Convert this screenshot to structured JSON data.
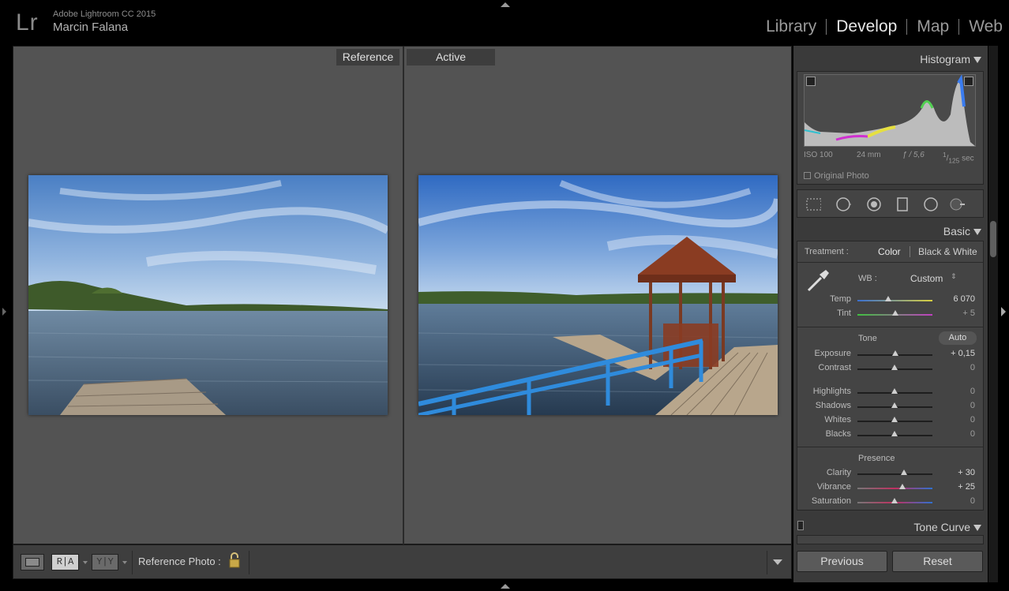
{
  "app": {
    "title": "Adobe Lightroom CC 2015",
    "user": "Marcin Falana",
    "logo": "Lr"
  },
  "modules": [
    {
      "label": "Library",
      "active": false
    },
    {
      "label": "Develop",
      "active": true
    },
    {
      "label": "Map",
      "active": false
    },
    {
      "label": "Web",
      "active": false
    }
  ],
  "compare": {
    "reference_label": "Reference",
    "active_label": "Active"
  },
  "toolbar": {
    "reference_photo_label": "Reference Photo :",
    "view_ra": "R|A",
    "view_yy": "Y|Y"
  },
  "histogram": {
    "title": "Histogram",
    "iso": "ISO 100",
    "focal": "24 mm",
    "aperture": "ƒ / 5,6",
    "shutter_num": "1",
    "shutter_den": "125",
    "shutter_unit": "sec",
    "original_photo": "Original Photo"
  },
  "basic": {
    "title": "Basic",
    "treatment_label": "Treatment :",
    "treatment_color": "Color",
    "treatment_bw": "Black & White",
    "wb_label": "WB :",
    "wb_value": "Custom",
    "temp": {
      "label": "Temp",
      "value": "6 070",
      "pos": 0.42
    },
    "tint": {
      "label": "Tint",
      "value": "+ 5",
      "pos": 0.52
    },
    "tone_label": "Tone",
    "auto_label": "Auto",
    "exposure": {
      "label": "Exposure",
      "value": "+ 0,15",
      "pos": 0.51
    },
    "contrast": {
      "label": "Contrast",
      "value": "0",
      "pos": 0.5
    },
    "highlights": {
      "label": "Highlights",
      "value": "0",
      "pos": 0.5
    },
    "shadows": {
      "label": "Shadows",
      "value": "0",
      "pos": 0.5
    },
    "whites": {
      "label": "Whites",
      "value": "0",
      "pos": 0.5
    },
    "blacks": {
      "label": "Blacks",
      "value": "0",
      "pos": 0.5
    },
    "presence_label": "Presence",
    "clarity": {
      "label": "Clarity",
      "value": "+ 30",
      "pos": 0.63
    },
    "vibrance": {
      "label": "Vibrance",
      "value": "+ 25",
      "pos": 0.61
    },
    "saturation": {
      "label": "Saturation",
      "value": "0",
      "pos": 0.5
    }
  },
  "tone_curve": {
    "title": "Tone Curve"
  },
  "buttons": {
    "previous": "Previous",
    "reset": "Reset"
  }
}
